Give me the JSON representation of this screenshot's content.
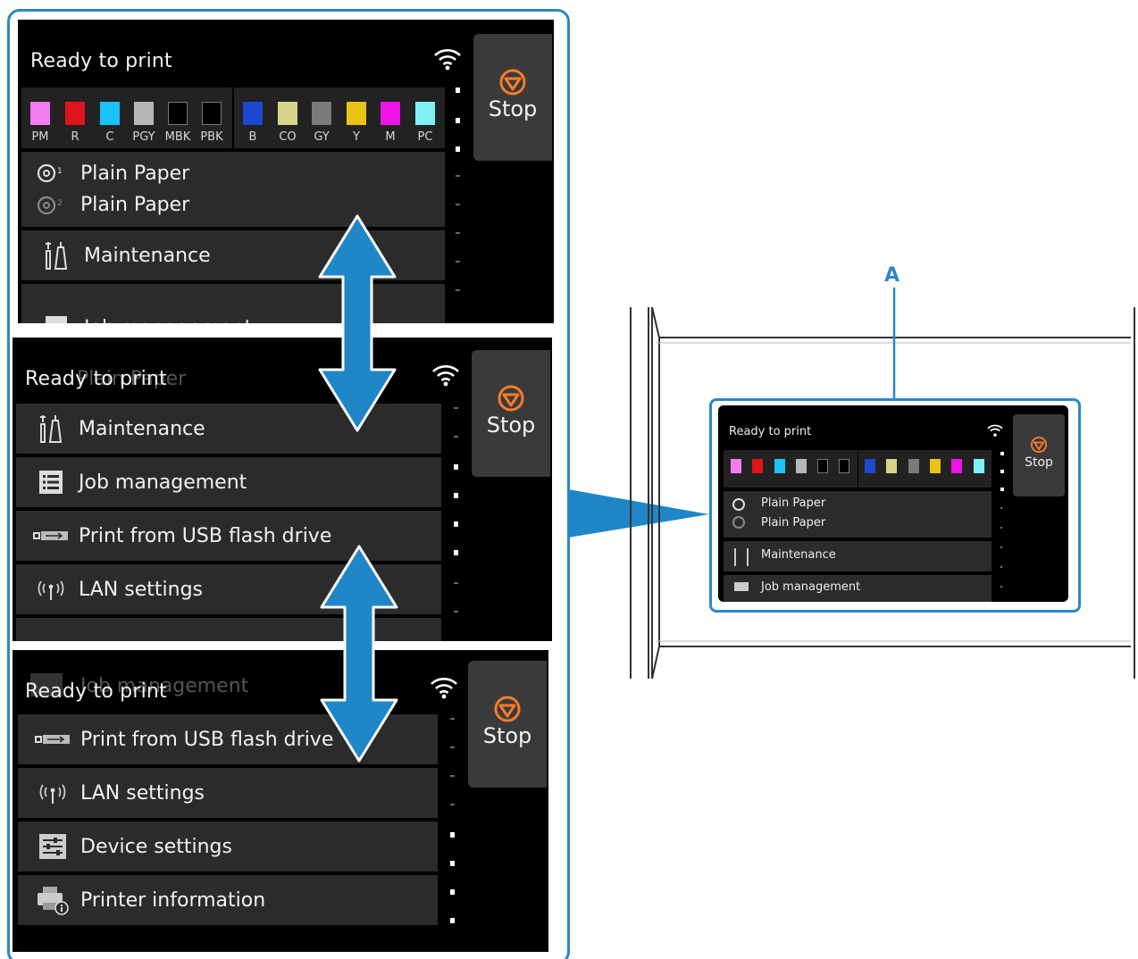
{
  "status_text": "Ready to print",
  "stop_label": "Stop",
  "callout_label": "A",
  "ink_tanks": [
    {
      "code": "PM",
      "color": "#f27df0"
    },
    {
      "code": "R",
      "color": "#e0141b"
    },
    {
      "code": "C",
      "color": "#19c3f3"
    },
    {
      "code": "PGY",
      "color": "#b7b7b7"
    },
    {
      "code": "MBK",
      "color": "#000000"
    },
    {
      "code": "PBK",
      "color": "#000000"
    },
    {
      "code": "B",
      "color": "#1c47cf"
    },
    {
      "code": "CO",
      "color": "#d7d48a"
    },
    {
      "code": "GY",
      "color": "#7a7a7a"
    },
    {
      "code": "Y",
      "color": "#e9c316"
    },
    {
      "code": "M",
      "color": "#ee14e6"
    },
    {
      "code": "PC",
      "color": "#7ff1f4"
    }
  ],
  "paper": {
    "roll1": "Plain Paper",
    "roll2": "Plain Paper"
  },
  "menu": {
    "maintenance": "Maintenance",
    "job_management": "Job management",
    "print_usb": "Print from USB flash drive",
    "lan_settings": "LAN settings",
    "device_settings": "Device settings",
    "printer_information": "Printer information"
  },
  "ghost": {
    "panel2": "Plain Paper",
    "panel3": "Job management"
  },
  "colors": {
    "accent": "#2f86c6",
    "panel_bg": "#000000",
    "row_bg": "#2b2b2b",
    "stop_icon": "#f57c2a"
  }
}
